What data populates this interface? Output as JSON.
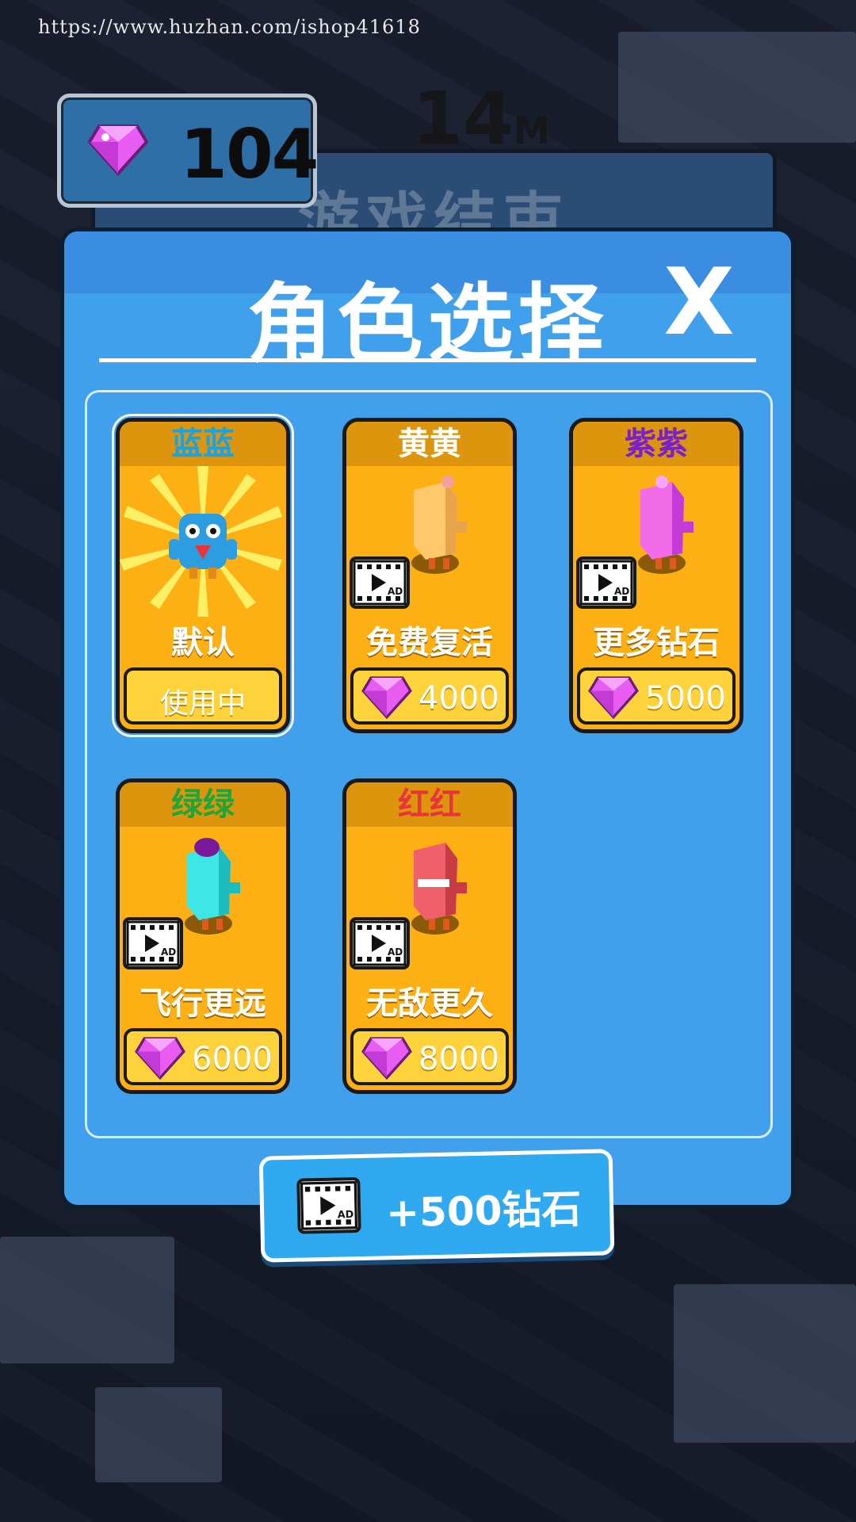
{
  "watermark": "https://www.huzhan.com/ishop41618",
  "hud": {
    "gem_count": "104"
  },
  "background_overlay": {
    "distance": "14",
    "distance_unit": "M",
    "game_over_title": "游戏结束"
  },
  "dialog": {
    "title": "角色选择",
    "close_label": "X"
  },
  "characters": [
    {
      "name": "蓝蓝",
      "name_color": "#1aa3e0",
      "perk": "默认",
      "price": "使用中",
      "state": "in-use"
    },
    {
      "name": "黄黄",
      "name_color": "#ffffff",
      "perk": "免费复活",
      "price": "4000",
      "state": "locked"
    },
    {
      "name": "紫紫",
      "name_color": "#7a22c6",
      "perk": "更多钻石",
      "price": "5000",
      "state": "locked"
    },
    {
      "name": "绿绿",
      "name_color": "#1fa63a",
      "perk": "飞行更远",
      "price": "6000",
      "state": "locked"
    },
    {
      "name": "红红",
      "name_color": "#e8343a",
      "perk": "无敌更久",
      "price": "8000",
      "state": "locked"
    }
  ],
  "bonus_button": {
    "label": "+500钻石"
  },
  "colors": {
    "dialog_bg": "#41a0ec",
    "card_bg": "#fdb014",
    "gem": "#e85cf2",
    "button": "#2fa9ef"
  },
  "icons": [
    "gem-icon",
    "video-ad-icon",
    "close-icon"
  ]
}
